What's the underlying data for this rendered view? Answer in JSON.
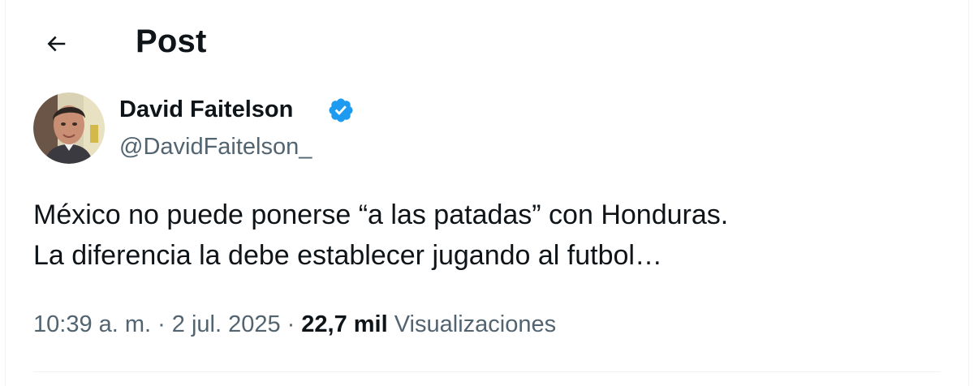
{
  "header": {
    "back_icon": "arrow-left-icon",
    "title": "Post"
  },
  "author": {
    "avatar_icon": "avatar-photo",
    "display_name": "David Faitelson",
    "verified_icon": "verified-badge-icon",
    "verified_color": "#1d9bf0",
    "handle": "@DavidFaitelson_"
  },
  "tweet": {
    "lines": [
      "México no puede ponerse “a las patadas” con Honduras.",
      "La diferencia la debe establecer jugando al futbol…"
    ]
  },
  "meta": {
    "time": "10:39 a. m.",
    "separator": "·",
    "date": "2 jul. 2025",
    "views_count": "22,7 mil",
    "views_label": "Visualizaciones"
  },
  "colors": {
    "text_primary": "#0f1419",
    "text_secondary": "#536471",
    "border": "#eff3f4"
  }
}
